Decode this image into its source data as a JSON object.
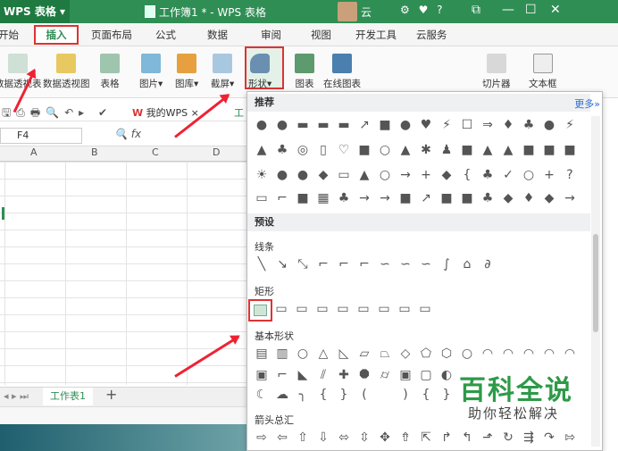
{
  "titlebar": {
    "app_label": "WPS 表格",
    "doc_title": "工作簿1 * - WPS 表格",
    "user_name": "云",
    "help": "?"
  },
  "tabs": [
    "开始",
    "插入",
    "页面布局",
    "公式",
    "数据",
    "审阅",
    "视图",
    "开发工具",
    "云服务"
  ],
  "ribbon": {
    "pivot_chart_partial": "数据透视表",
    "pivot_chart": "数据透视图",
    "table": "表格",
    "picture": "图片",
    "library": "图库",
    "screenshot": "截屏",
    "shapes": "形状",
    "chart": "图表",
    "online_chart": "在线图表",
    "slicer": "切片器",
    "textbox": "文本框"
  },
  "quickbar": {
    "mywps": "我的WPS",
    "close": "×",
    "workbook_partial": "工"
  },
  "namebox": {
    "value": "F4",
    "fx": "fx"
  },
  "columns": [
    "A",
    "B",
    "C",
    "D"
  ],
  "sheet_tab": "工作表1",
  "panel": {
    "recommend": "推荐",
    "more": "更多»",
    "preset": "预设",
    "lines": "线条",
    "rectangles": "矩形",
    "basic_shapes": "基本形状",
    "arrows": "箭头总汇"
  },
  "watermark": {
    "title": "百科全说",
    "subtitle": "助你轻松解决"
  },
  "colors": {
    "wps_green": "#2f8e54",
    "highlight_red": "#dd3333"
  }
}
